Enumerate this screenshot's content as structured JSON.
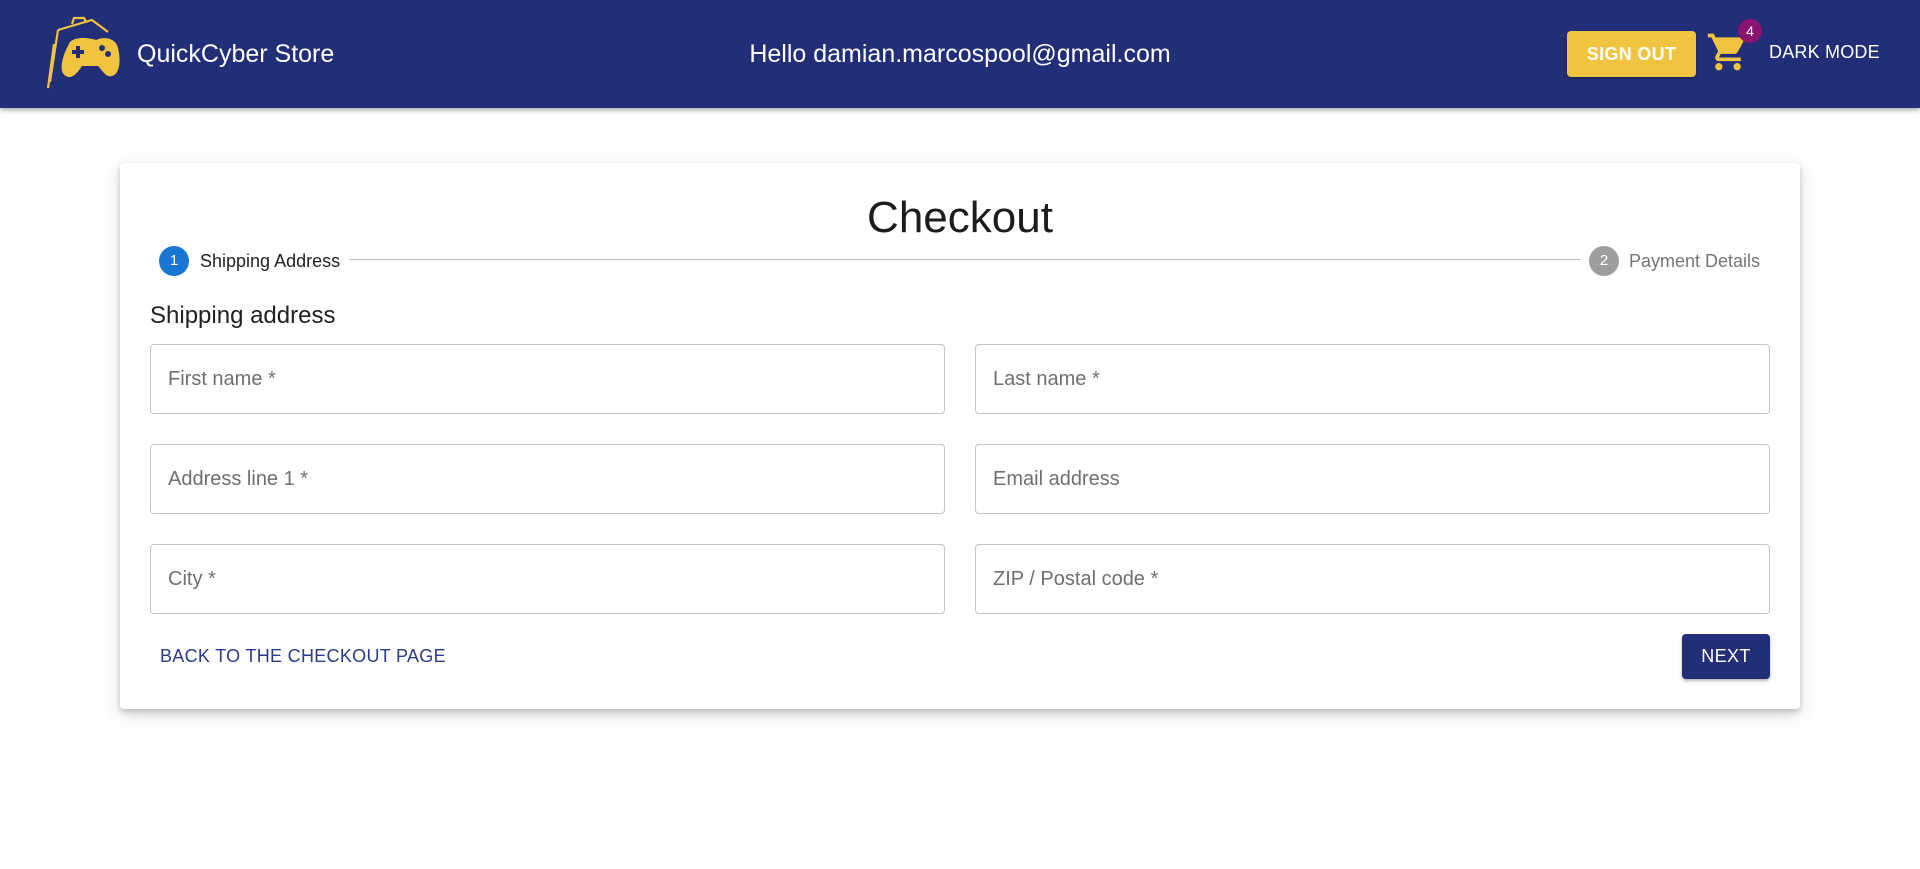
{
  "header": {
    "brand": "QuickCyber Store",
    "greeting": "Hello damian.marcospool@gmail.com",
    "sign_out_label": "SIGN OUT",
    "cart_count": "4",
    "dark_mode_label": "DARK MODE",
    "logo_icon": "gamepad-bag-icon",
    "cart_icon": "shopping-cart-icon"
  },
  "checkout": {
    "title": "Checkout",
    "steps": [
      {
        "number": "1",
        "label": "Shipping Address",
        "active": true
      },
      {
        "number": "2",
        "label": "Payment Details",
        "active": false
      }
    ],
    "section_title": "Shipping address",
    "fields": [
      {
        "placeholder": "First name *",
        "value": ""
      },
      {
        "placeholder": "Last name *",
        "value": ""
      },
      {
        "placeholder": "Address line 1 *",
        "value": ""
      },
      {
        "placeholder": "Email address",
        "value": ""
      },
      {
        "placeholder": "City *",
        "value": ""
      },
      {
        "placeholder": "ZIP / Postal code *",
        "value": ""
      }
    ],
    "back_label": "BACK TO THE CHECKOUT PAGE",
    "next_label": "NEXT"
  },
  "colors": {
    "appbar": "#222e78",
    "accent_yellow": "#f0c43f",
    "step_active": "#1976d2",
    "step_inactive": "#9e9e9e",
    "badge": "#8a1570"
  }
}
